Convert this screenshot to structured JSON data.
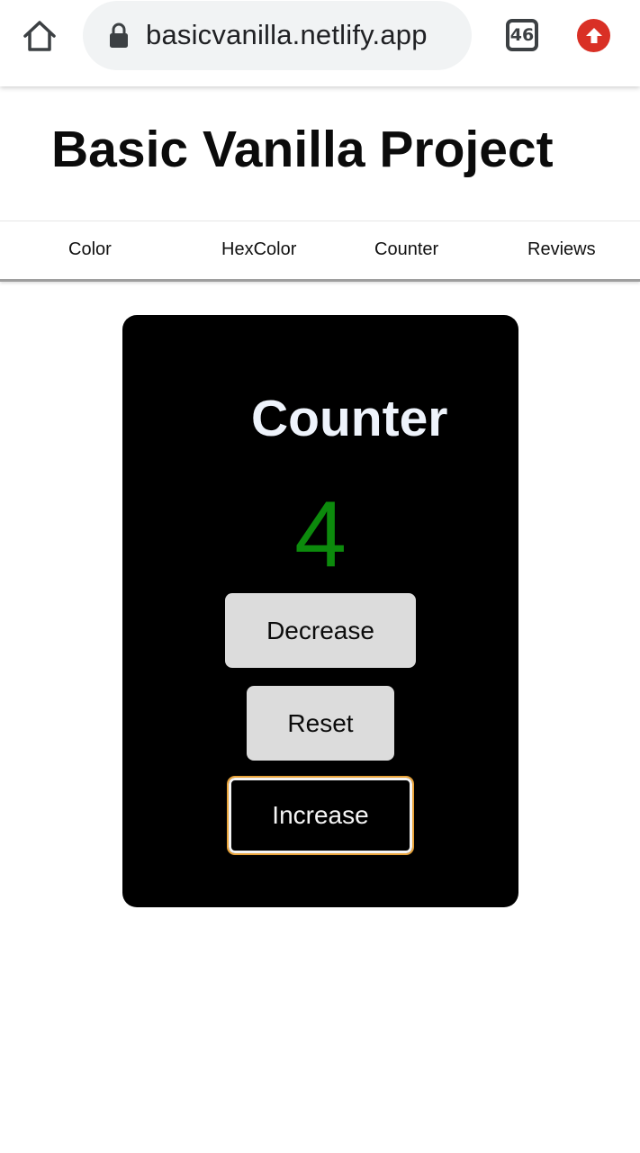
{
  "browser": {
    "url": "basicvanilla.netlify.app",
    "tab_count": "46",
    "icons": {
      "home": "home-icon",
      "lock": "lock-icon",
      "tabs": "tab-switcher-icon",
      "update": "update-arrow-icon"
    },
    "colors": {
      "update_badge": "#d93025",
      "url_bar": "#f1f3f4"
    }
  },
  "page": {
    "title": "Basic Vanilla Project",
    "nav": [
      {
        "label": "Color"
      },
      {
        "label": "HexColor"
      },
      {
        "label": "Counter"
      },
      {
        "label": "Reviews"
      }
    ]
  },
  "counter": {
    "title": "Counter",
    "value": "4",
    "buttons": {
      "decrease": "Decrease",
      "reset": "Reset",
      "increase": "Increase"
    },
    "colors": {
      "card_background": "#000000",
      "value_color": "#0c8a0c",
      "button_background": "#dcdcdc",
      "focus_outline": "#e8a33a"
    }
  }
}
